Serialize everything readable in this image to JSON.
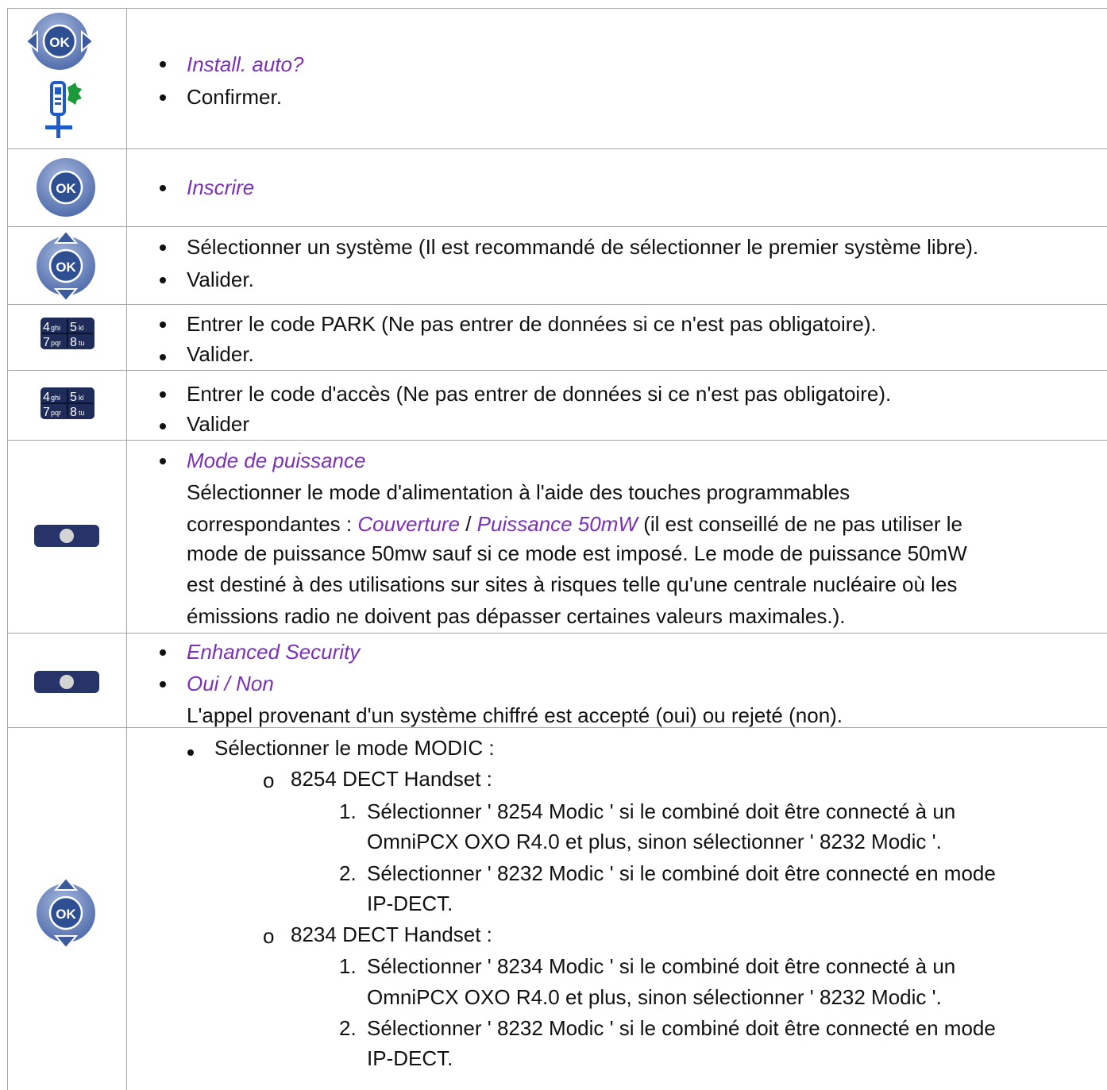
{
  "rows": {
    "install": {
      "icons": [
        "ok-nav-left-right-icon",
        "handset-install-icon"
      ],
      "items": [
        {
          "text": "Install. auto?",
          "style": "italic"
        },
        {
          "text": "Confirmer.",
          "style": "normal"
        }
      ]
    },
    "inscrire": {
      "icons": [
        "ok-button-icon"
      ],
      "items": [
        {
          "text": "Inscrire",
          "style": "italic"
        }
      ]
    },
    "systeme": {
      "icons": [
        "ok-nav-up-down-icon"
      ],
      "items": [
        {
          "text": "Sélectionner un système (Il est recommandé de sélectionner le premier système libre).",
          "style": "normal"
        },
        {
          "text": "Valider.",
          "style": "normal"
        }
      ]
    },
    "park": {
      "icons": [
        "keypad-icon"
      ],
      "keypad": {
        "k1": "4",
        "k1s": "ghi",
        "k2": "5",
        "k2s": "kl",
        "k3": "7",
        "k3s": "pqr",
        "k4": "8",
        "k4s": "tu"
      },
      "items": [
        {
          "text": "Entrer le code PARK (Ne pas entrer de données si ce n'est pas obligatoire).",
          "style": "normal"
        },
        {
          "text": "Valider.",
          "style": "normal"
        }
      ]
    },
    "acces": {
      "icons": [
        "keypad-icon"
      ],
      "items": [
        {
          "text": "Entrer le code d'accès (Ne pas entrer de données si ce n'est pas obligatoire).",
          "style": "normal"
        },
        {
          "text": "Valider",
          "style": "normal"
        }
      ]
    },
    "puissance": {
      "icons": [
        "softkey-icon"
      ],
      "title": "Mode de puissance",
      "line1": "Sélectionner le mode d'alimentation à l'aide des touches programmables",
      "line2_pre": "correspondantes : ",
      "line2_opt1": "Couverture",
      "line2_sep": " / ",
      "line2_opt2": "Puissance 50mW",
      "line2_post": " (il est conseillé de ne pas utiliser le",
      "line3": "mode de puissance 50mw sauf si ce mode est imposé. Le mode de puissance 50mW",
      "line4": "est destiné à des utilisations sur sites à risques telle qu'une centrale nucléaire où les",
      "line5": "émissions radio ne doivent pas dépasser certaines valeurs maximales.)."
    },
    "security": {
      "icons": [
        "softkey-icon"
      ],
      "item1": "Enhanced Security",
      "item2": "Oui / Non",
      "note": "L'appel provenant d'un système chiffré est accepté (oui) ou rejeté (non)."
    },
    "modic": {
      "icons": [
        "ok-nav-up-down-icon"
      ],
      "title": "Sélectionner le mode MODIC :",
      "handset1": {
        "label": "8254 DECT Handset :",
        "step1_a": "Sélectionner ' 8254 Modic ' si le combiné doit être connecté à un",
        "step1_b": "OmniPCX OXO R4.0 et plus, sinon sélectionner ' 8232 Modic '.",
        "step2_a": "Sélectionner ' 8232 Modic ' si le combiné doit être connecté en mode",
        "step2_b": "IP-DECT."
      },
      "handset2": {
        "label": "8234 DECT Handset :",
        "step1_a": "Sélectionner ' 8234 Modic ' si le combiné doit être connecté à un",
        "step1_b": "OmniPCX OXO R4.0 et plus, sinon sélectionner ' 8232 Modic '.",
        "step2_a": "Sélectionner ' 8232 Modic ' si le combiné doit être connecté en mode",
        "step2_b": "IP-DECT."
      },
      "num1": "1.",
      "num2": "2.",
      "sub_bullet": "o"
    },
    "ok_label": "OK"
  },
  "colors": {
    "italic_text": "#7a31b6",
    "ok_button_dark": "#3b5a9a",
    "ok_button_light": "#8fa6cf",
    "softkey": "#26346a",
    "keypad_bg": "#1f2c5a"
  }
}
